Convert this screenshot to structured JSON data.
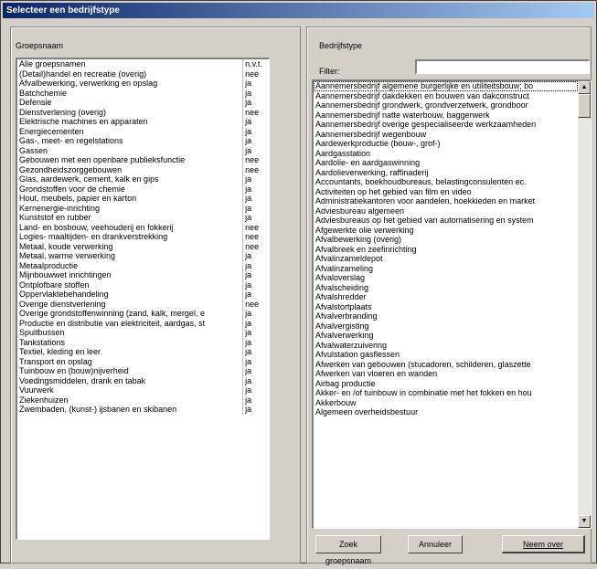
{
  "window": {
    "title": "Selecteer een bedrijfstype"
  },
  "left": {
    "label": "Groepsnaam",
    "groups": [
      {
        "name": "Alle groepsnamen",
        "flag": "n.v.t."
      },
      {
        "name": "(Detail)handel en recreatie (overig)",
        "flag": "nee"
      },
      {
        "name": "Afvalbewerking, verwerking en opslag",
        "flag": "ja"
      },
      {
        "name": "Batchchemie",
        "flag": "ja"
      },
      {
        "name": "Defensie",
        "flag": "ja"
      },
      {
        "name": "Dienstverlening (overig)",
        "flag": "nee"
      },
      {
        "name": "Elektrische machines en apparaten",
        "flag": "ja"
      },
      {
        "name": "Energiecementen",
        "flag": "ja"
      },
      {
        "name": "Gas-, meet- en regelstations",
        "flag": "ja"
      },
      {
        "name": "Gassen",
        "flag": "ja"
      },
      {
        "name": "Gebouwen met een openbare publieksfunctie",
        "flag": "nee"
      },
      {
        "name": "Gezondheidszorggebouwen",
        "flag": "nee"
      },
      {
        "name": "Glas, aardewerk, cement, kalk en gips",
        "flag": "ja"
      },
      {
        "name": "Grondstoffen voor de chemie",
        "flag": "ja"
      },
      {
        "name": "Hout, meubels, papier en karton",
        "flag": "ja"
      },
      {
        "name": "Kernenergie-inrichting",
        "flag": "ja"
      },
      {
        "name": "Kunststof en rubber",
        "flag": "ja"
      },
      {
        "name": "Land- en bosbouw, veehouderij en fokkerij",
        "flag": "nee"
      },
      {
        "name": "Logies- maaltijden- en drankverstrekking",
        "flag": "nee"
      },
      {
        "name": "Metaal, koude verwerking",
        "flag": "nee"
      },
      {
        "name": "Metaal, warme verwerking",
        "flag": "ja"
      },
      {
        "name": "Metaalproductie",
        "flag": "ja"
      },
      {
        "name": "Mijnbouwwet inrichtingen",
        "flag": "ja"
      },
      {
        "name": "Ontplofbare stoffen",
        "flag": "ja"
      },
      {
        "name": "Oppervlaktebehandeling",
        "flag": "ja"
      },
      {
        "name": "Overige dienstverlening",
        "flag": "nee"
      },
      {
        "name": "Overige grondstoffenwinning (zand, kalk, mergel, e",
        "flag": "ja"
      },
      {
        "name": "Productie en distributie van elektriciteit, aardgas, st",
        "flag": "ja"
      },
      {
        "name": "Spuitbussen",
        "flag": "ja"
      },
      {
        "name": "Tankstations",
        "flag": "ja"
      },
      {
        "name": "Textiel, kleding en leer",
        "flag": "ja"
      },
      {
        "name": "Transport en opslag",
        "flag": "ja"
      },
      {
        "name": "Tuinbouw en (bouw)nijverheid",
        "flag": "ja"
      },
      {
        "name": "Voedingsmiddelen, drank en tabak",
        "flag": "ja"
      },
      {
        "name": "Vuurwerk",
        "flag": "ja"
      },
      {
        "name": "Ziekenhuizen",
        "flag": "ja"
      },
      {
        "name": "Zwembaden, (kunst-) ijsbanen en skibanen",
        "flag": "ja"
      }
    ]
  },
  "right": {
    "label": "Bedrijfstype",
    "filter_label": "Filter:",
    "filter_value": "",
    "types": [
      "Aannemersbedrijf algemene burgerlijke en utiliteitsbouw; bo",
      "Aannemersbedrijf dakdekken en bouwen van dakconstruct",
      "Aannemersbedrijf grondwerk, grondverzetwerk, grondboor",
      "Aannemersbedrijf natte waterbouw, baggerwerk",
      "Aannemersbedrijf overige gespecialiseerde werkzaamheden",
      "Aannemersbedrijf wegenbouw",
      "Aardewerkproductie (bouw-, grof-)",
      "Aardgasstation",
      "Aardolie- en aardgaswinning",
      "Aardolieverwerking, raffinaderij",
      "Accountants, boekhoudbureaus, belastingconsulenten ec.",
      "Activiteiten op het gebied van film en video",
      "Administratiekantoren voor aandelen, hoekkieden en market",
      "Adviesbureau algemeen",
      "Adviesbureaus op het gebied van automatisering en system",
      "Afgewerkte olie verwerking",
      "Afvalbewerking (overig)",
      "Afvalbreek en zeefinrichting",
      "Afvalinzameldepot",
      "Afvalinzameling",
      "Afvaloverslag",
      "Afvalscheiding",
      "Afvalshredder",
      "Afvalstortplaats",
      "Afvalverbranding",
      "Afvalvergisting",
      "Afvalverwerking",
      "Afvalwaterzuivering",
      "Afvulstation gasflessen",
      "Afwerken van gebouwen (stucadoren, schilderen, glaszette",
      "Afwerken van vloeren en wanden",
      "Airbag productie",
      "Akker- en /of tuinbouw in combinatie met het fokken en hou",
      "Akkerbouw",
      "Algemeen overheidsbestuur"
    ],
    "scroll_up": "▲",
    "scroll_down": "▼"
  },
  "buttons": {
    "search": "Zoek groepsnaam",
    "cancel": "Annuleer",
    "ok": "Neem over"
  }
}
